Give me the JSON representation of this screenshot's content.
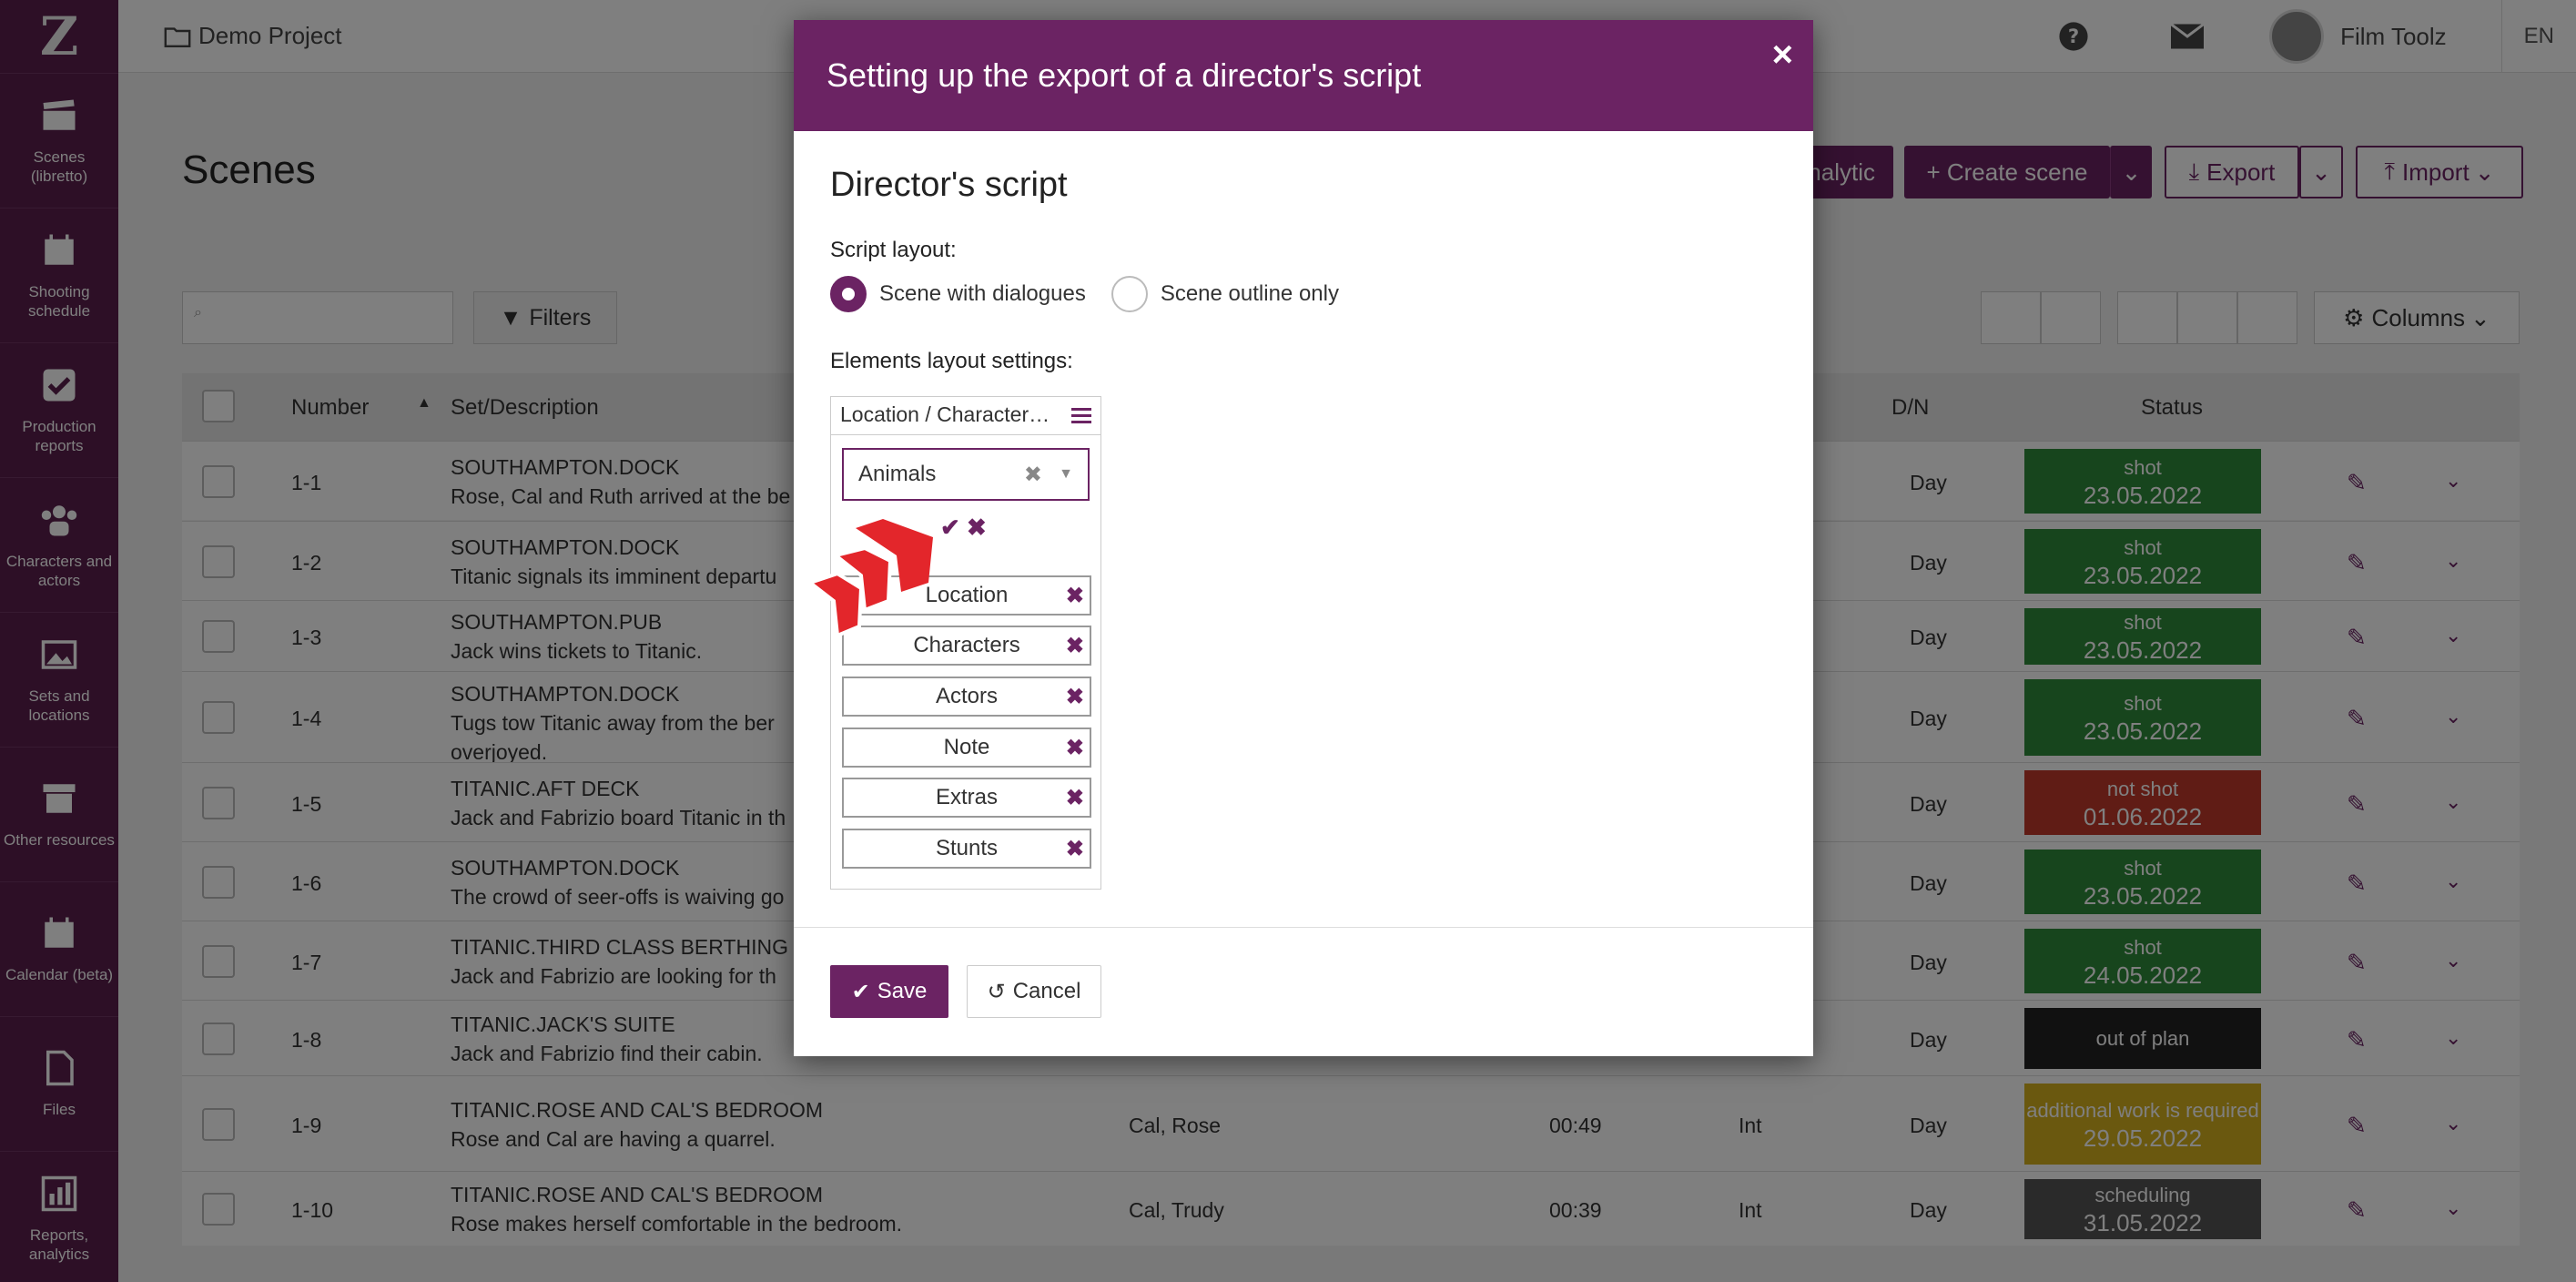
{
  "sidebar": {
    "logo": "Z",
    "items": [
      {
        "label": "Scenes (libretto)",
        "icon": "clapperboard-icon"
      },
      {
        "label": "Shooting schedule",
        "icon": "calendar-icon"
      },
      {
        "label": "Production reports",
        "icon": "checkbox-icon"
      },
      {
        "label": "Characters and actors",
        "icon": "people-icon"
      },
      {
        "label": "Sets and locations",
        "icon": "image-icon"
      },
      {
        "label": "Other resources",
        "icon": "archive-box-icon"
      },
      {
        "label": "Calendar (beta)",
        "icon": "calendar-icon"
      },
      {
        "label": "Files",
        "icon": "file-icon"
      },
      {
        "label": "Reports, analytics",
        "icon": "bar-chart-icon"
      }
    ]
  },
  "topbar": {
    "project": "Demo Project",
    "user": "Film Toolz",
    "lang": "EN"
  },
  "page": {
    "title": "Scenes",
    "analytic": "nalytic",
    "create_scene": "+ Create scene",
    "export": "Export",
    "import": "Import",
    "filters": "Filters",
    "columns": "Columns"
  },
  "table": {
    "headers": {
      "number": "Number",
      "set": "Set/Description",
      "dn": "D/N",
      "status": "Status"
    },
    "rows": [
      {
        "num": "1-1",
        "set": "SOUTHAMPTON.DOCK",
        "desc": "Rose, Cal and Ruth arrived at the be",
        "chars": "",
        "time": "",
        "ie": "",
        "dn": "Day",
        "status": "shot",
        "date": "23.05.2022"
      },
      {
        "num": "1-2",
        "set": "SOUTHAMPTON.DOCK",
        "desc": "Titanic signals its imminent departu",
        "chars": "",
        "time": "",
        "ie": "",
        "dn": "Day",
        "status": "shot",
        "date": "23.05.2022"
      },
      {
        "num": "1-3",
        "set": "SOUTHAMPTON.PUB",
        "desc": "Jack wins tickets to Titanic.",
        "chars": "",
        "time": "",
        "ie": "",
        "dn": "Day",
        "status": "shot",
        "date": "23.05.2022"
      },
      {
        "num": "1-4",
        "set": "SOUTHAMPTON.DOCK",
        "desc": "Tugs tow Titanic away from the ber",
        "desc2": "overjoyed.",
        "chars": "",
        "time": "",
        "ie": "",
        "dn": "Day",
        "status": "shot",
        "date": "23.05.2022"
      },
      {
        "num": "1-5",
        "set": "TITANIC.AFT DECK",
        "desc": "Jack and Fabrizio board Titanic in th",
        "chars": "",
        "time": "",
        "ie": "",
        "dn": "Day",
        "status": "not shot",
        "date": "01.06.2022"
      },
      {
        "num": "1-6",
        "set": "SOUTHAMPTON.DOCK",
        "desc": "The crowd of seer-offs is waiving go",
        "chars": "",
        "time": "",
        "ie": "",
        "dn": "Day",
        "status": "shot",
        "date": "23.05.2022"
      },
      {
        "num": "1-7",
        "set": "TITANIC.THIRD CLASS BERTHING",
        "desc": "Jack and Fabrizio are looking for th",
        "chars": "",
        "time": "",
        "ie": "",
        "dn": "Day",
        "status": "shot",
        "date": "24.05.2022"
      },
      {
        "num": "1-8",
        "set": "TITANIC.JACK'S SUITE",
        "desc": "Jack and Fabrizio find their cabin.",
        "chars": "",
        "time": "",
        "ie": "",
        "dn": "Day",
        "status": "out of plan",
        "date": ""
      },
      {
        "num": "1-9",
        "set": "TITANIC.ROSE AND CAL'S BEDROOM",
        "desc": "Rose and Cal are having a quarrel.",
        "chars": "Cal, Rose",
        "time": "00:49",
        "ie": "Int",
        "dn": "Day",
        "status": "additional work is required",
        "date": "29.05.2022"
      },
      {
        "num": "1-10",
        "set": "TITANIC.ROSE AND CAL'S BEDROOM",
        "desc": "Rose makes herself comfortable in the bedroom.",
        "chars": "Cal, Trudy",
        "time": "00:39",
        "ie": "Int",
        "dn": "Day",
        "status": "scheduling",
        "date": "31.05.2022"
      }
    ]
  },
  "modal": {
    "title": "Setting up the export of a director's script",
    "heading": "Director's script",
    "layout_label": "Script layout:",
    "radio1": "Scene with dialogues",
    "radio2": "Scene outline only",
    "elements_label": "Elements layout settings:",
    "panel_title": "Location / Character…",
    "select_value": "Animals",
    "tags": [
      "Location",
      "Characters",
      "Actors",
      "Note",
      "Extras",
      "Stunts"
    ],
    "save": "Save",
    "cancel": "Cancel"
  },
  "colors": {
    "brand": "#6b2363",
    "sidebar": "#5a1e4d",
    "shot": "#2e8b3a",
    "not_shot": "#c0392b",
    "out_of_plan": "#222222",
    "additional": "#d4b11f",
    "scheduling": "#555555"
  }
}
